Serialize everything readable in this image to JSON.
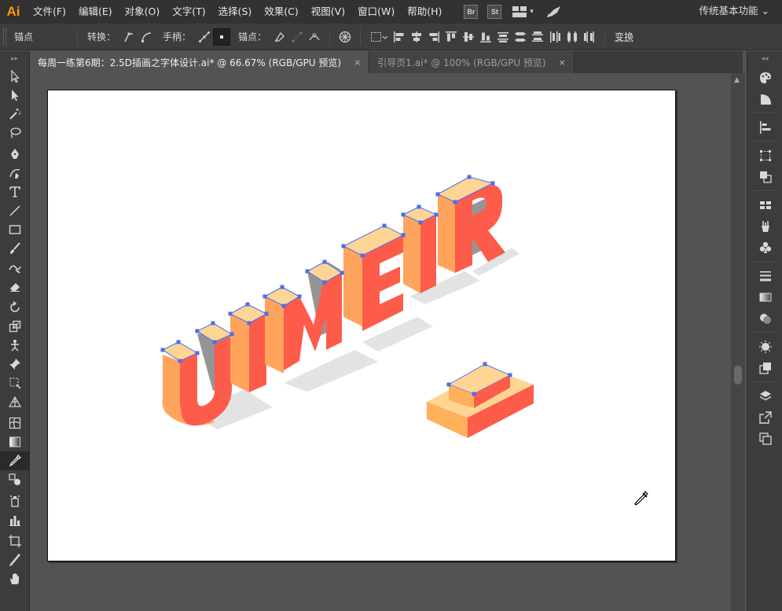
{
  "app": {
    "logo": "Ai",
    "workspace": "传统基本功能 ⌄"
  },
  "menu": [
    "文件(F)",
    "编辑(E)",
    "对象(O)",
    "文字(T)",
    "选择(S)",
    "效果(C)",
    "视图(V)",
    "窗口(W)",
    "帮助(H)"
  ],
  "app_badges": [
    "Br",
    "St"
  ],
  "control_bar": {
    "anchor_label": "锚点",
    "convert_label": "转换：",
    "handles_label": "手柄：",
    "anchors_label": "锚点：",
    "transform_label": "变换"
  },
  "tabs": [
    {
      "label": "每周一练第6期：2.5D插画之字体设计.ai* @ 66.67% (RGB/GPU 预览)",
      "close": "×",
      "active": true
    },
    {
      "label": "引导页1.ai* @ 100% (RGB/GPU 预览)",
      "close": "×",
      "active": false
    }
  ],
  "left_toolbar": {
    "collapse": "▸▸",
    "tools": [
      "selection-tool",
      "direct-selection-tool",
      "magic-wand-tool",
      "lasso-tool",
      "pen-tool",
      "curvature-tool",
      "type-tool",
      "line-tool",
      "rectangle-tool",
      "paintbrush-tool",
      "shaper-tool",
      "eraser-tool",
      "rotate-tool",
      "scale-tool",
      "puppet-warp-tool",
      "pin-tool",
      "free-transform-tool",
      "perspective-grid-tool",
      "mesh-tool",
      "gradient-tool",
      "eyedropper-tool",
      "blend-tool",
      "symbol-sprayer-tool",
      "column-graph-tool",
      "artboard-tool",
      "slice-tool",
      "hand-tool"
    ],
    "selected": "eyedropper-tool"
  },
  "right_dock": {
    "collapse": "◂◂",
    "panels": [
      "color-panel",
      "color-guide-panel",
      "align-panel",
      "transform-panel",
      "pathfinder-panel",
      "swatches-panel",
      "brushes-panel",
      "symbols-panel",
      "stroke-panel",
      "gradient-panel",
      "transparency-panel",
      "appearance-panel",
      "graphic-styles-panel",
      "layers-panel",
      "export-panel",
      "artboards-panel"
    ]
  },
  "artwork": {
    "letters": [
      "U",
      "I",
      "M",
      "E",
      "I",
      "R"
    ],
    "colors": {
      "front": "#fd5c4b",
      "side": "#ffa45d",
      "top": "#ffd596",
      "shadow": "#e3e3e3",
      "gray_face": "#959595",
      "selection": "#4a6ef0",
      "base_top": "#ffd591",
      "base_side": "#ffb05a",
      "base_front": "#fd5c4b"
    }
  }
}
